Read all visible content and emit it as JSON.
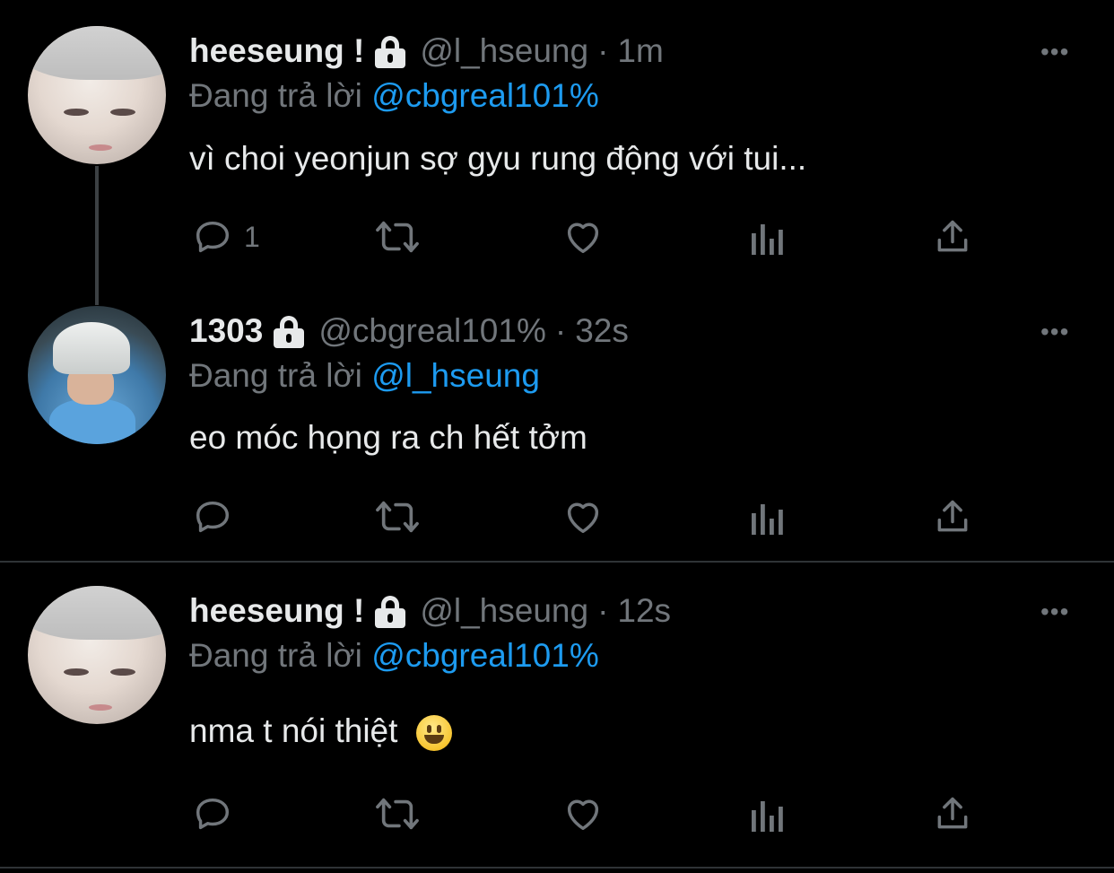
{
  "tweets": [
    {
      "display_name": "heeseung !",
      "handle": "@l_hseung",
      "separator": "·",
      "time": "1m",
      "replying_prefix": "Đang trả lời",
      "replying_to": "@cbgreal101%",
      "text": " vì choi yeonjun sợ gyu rung động với tui...",
      "reply_count": "1",
      "avatar": "heeseung-avatar",
      "more_label": "•••"
    },
    {
      "display_name": "1303",
      "handle": "@cbgreal101%",
      "separator": "·",
      "time": "32s",
      "replying_prefix": "Đang trả lời",
      "replying_to": "@l_hseung",
      "text": "eo móc họng ra ch hết tởm",
      "reply_count": "",
      "avatar": "kid-helmet-avatar",
      "more_label": "•••"
    },
    {
      "display_name": "heeseung !",
      "handle": "@l_hseung",
      "separator": "·",
      "time": "12s",
      "replying_prefix": "Đang trả lời",
      "replying_to": "@cbgreal101%",
      "text": "nma t nói thiệt ",
      "emoji": "grinning-face",
      "reply_count": "",
      "avatar": "heeseung-avatar",
      "more_label": "•••"
    }
  ],
  "icons": {
    "reply": "reply-icon",
    "retweet": "retweet-icon",
    "like": "heart-icon",
    "views": "analytics-icon",
    "share": "share-icon",
    "lock": "lock-icon",
    "more": "more-icon"
  },
  "colors": {
    "background": "#000000",
    "text": "#e7e9ea",
    "muted": "#71767b",
    "accent": "#1d9bf0",
    "divider": "#2f3336"
  }
}
